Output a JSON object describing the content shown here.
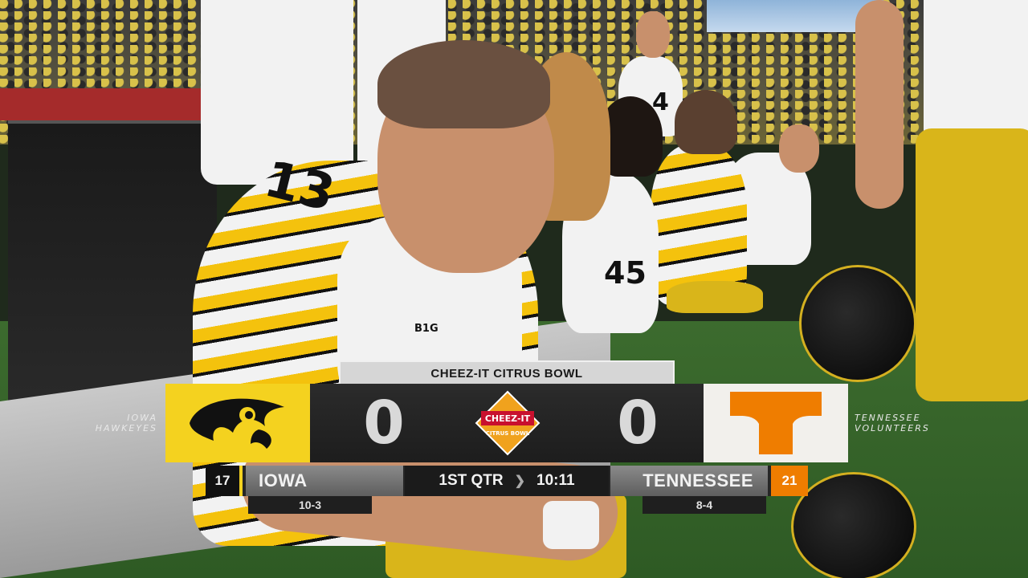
{
  "broadcast": {
    "bowl_title": "CHEEZ-IT CITRUS BOWL",
    "bowl_logo": {
      "line1": "CHEEZ-IT",
      "line2": "CITRUS BOWL"
    },
    "period": "1ST QTR",
    "clock": "10:11",
    "colors": {
      "iowa_gold": "#f4d21f",
      "tennessee_orange": "#ef7d00"
    }
  },
  "home_team": {
    "side_label_line1": "IOWA",
    "side_label_line2": "HAWKEYES",
    "rank": "17",
    "name": "IOWA",
    "score": "0",
    "record": "10-3",
    "logo": "hawkeye-icon"
  },
  "away_team": {
    "side_label_line1": "TENNESSEE",
    "side_label_line2": "VOLUNTEERS",
    "rank": "21",
    "name": "TENNESSEE",
    "score": "0",
    "record": "8-4",
    "logo": "power-t-icon"
  },
  "scene": {
    "jersey_numbers": [
      "13",
      "4",
      "45"
    ],
    "patch_text": "B1G"
  }
}
